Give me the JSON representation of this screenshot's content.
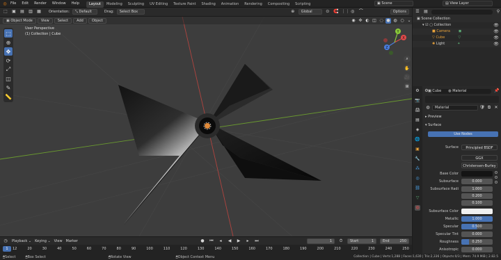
{
  "menubar": {
    "items": [
      "File",
      "Edit",
      "Render",
      "Window",
      "Help"
    ],
    "workspaces": [
      "Layout",
      "Modeling",
      "Sculpting",
      "UV Editing",
      "Texture Paint",
      "Shading",
      "Animation",
      "Rendering",
      "Compositing",
      "Scripting"
    ],
    "active_workspace": "Layout",
    "scene_label": "Scene",
    "view_layer_label": "View Layer"
  },
  "header": {
    "orientation_label": "Orientation:",
    "orientation_value": "Default",
    "drag_label": "Drag:",
    "drag_value": "Select Box",
    "transform_space": "Global",
    "options_label": "Options"
  },
  "viewport": {
    "mode": "Object Mode",
    "menus": [
      "View",
      "Select",
      "Add",
      "Object"
    ],
    "view_name": "User Perspective",
    "collection_info": "(1) Collection | Cube",
    "gizmo": {
      "x": "X",
      "y": "Y",
      "z": "Z"
    }
  },
  "outliner": {
    "root": "Scene Collection",
    "collection": "Collection",
    "objects": [
      {
        "name": "Camera",
        "icon": "camera-icon"
      },
      {
        "name": "Cube",
        "icon": "mesh-icon"
      },
      {
        "name": "Light",
        "icon": "light-icon"
      }
    ]
  },
  "properties": {
    "object_name": "Cube",
    "material_tab": "Material",
    "material_name": "Material",
    "sections": {
      "preview": "Preview",
      "surface": "Surface"
    },
    "use_nodes_label": "Use Nodes",
    "surface_label": "Surface",
    "surface_value": "Principled BSDF",
    "distribution": "GGX",
    "subsurface_method": "Christensen-Burley",
    "fields": [
      {
        "label": "Base Color",
        "value": ""
      },
      {
        "label": "Subsurface",
        "value": "0.000"
      },
      {
        "label": "Subsurface Radi",
        "value": "1.000"
      },
      {
        "label": "",
        "value": "0.200"
      },
      {
        "label": "",
        "value": "0.100"
      },
      {
        "label": "Subsurface Color",
        "value": ""
      },
      {
        "label": "Metallic",
        "value": "1.000"
      },
      {
        "label": "Specular",
        "value": "0.500"
      },
      {
        "label": "Specular Tint",
        "value": "0.000"
      },
      {
        "label": "Roughness",
        "value": "0.250"
      },
      {
        "label": "Anisotropic",
        "value": "0.000"
      }
    ]
  },
  "timeline": {
    "menus": [
      "Playback",
      "Keying",
      "View",
      "Marker"
    ],
    "current_frame": "1",
    "start_label": "Start",
    "start_value": "1",
    "end_label": "End",
    "end_value": "250",
    "ticks": [
      "0",
      "12",
      "20",
      "30",
      "40",
      "50",
      "60",
      "70",
      "80",
      "90",
      "100",
      "110",
      "120",
      "130",
      "140",
      "150",
      "160",
      "170",
      "180",
      "190",
      "200",
      "210",
      "220",
      "230",
      "240",
      "250"
    ]
  },
  "statusbar": {
    "select": "Select",
    "box_select": "Box Select",
    "rotate_view": "Rotate View",
    "context_menu": "Object Context Menu",
    "stats": "Collection | Cube | Verts:1,288 | Faces:1,630 | Tris:2,336 | Objects:0/3 | Mem: 74.9 MiB | 2.82.5"
  },
  "colors": {
    "accent": "#4772b3",
    "grid_x": "#b0443f",
    "grid_y": "#6a9a2f",
    "gizmo_x": "#e04a4a",
    "gizmo_y": "#8ac93a",
    "gizmo_z": "#4a7ee0"
  }
}
